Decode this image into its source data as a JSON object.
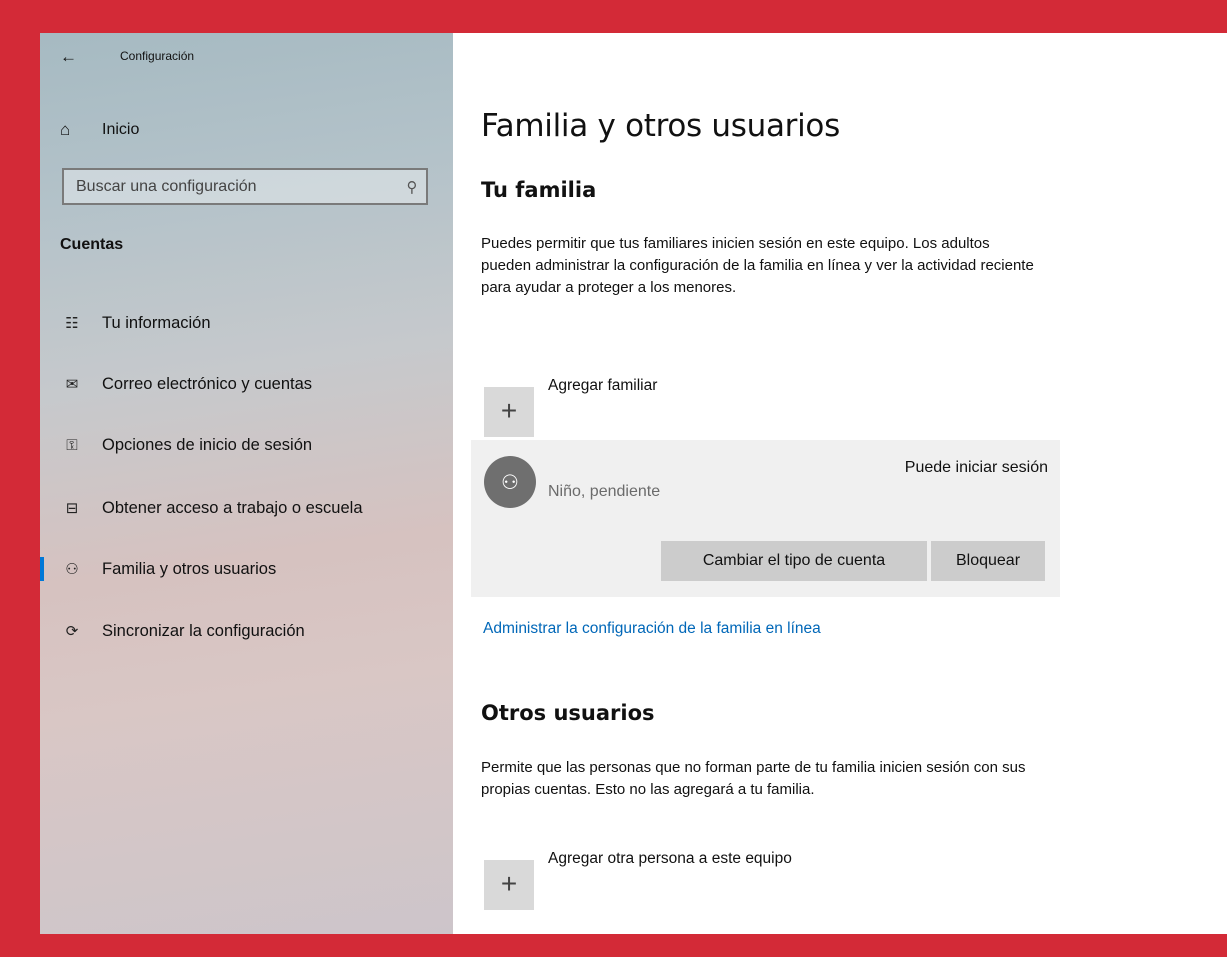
{
  "colors": {
    "frame": "#d32a37",
    "accent": "#0078d7",
    "link": "#0067b8"
  },
  "header": {
    "back_icon": "←",
    "app_title": "Configuración"
  },
  "sidebar": {
    "home": {
      "icon": "⌂",
      "label": "Inicio"
    },
    "search": {
      "placeholder": "Buscar una configuración",
      "icon": "⚲"
    },
    "section_heading": "Cuentas",
    "items": [
      {
        "icon": "☷",
        "icon_name": "contact-info-icon",
        "label": "Tu información",
        "active": false
      },
      {
        "icon": "✉",
        "icon_name": "mail-icon",
        "label": "Correo electrónico y cuentas",
        "active": false
      },
      {
        "icon": "⚿",
        "icon_name": "key-icon",
        "label": "Opciones de inicio de sesión",
        "active": false
      },
      {
        "icon": "⊟",
        "icon_name": "briefcase-icon",
        "label": "Obtener acceso a trabajo o escuela",
        "active": false
      },
      {
        "icon": "⚇",
        "icon_name": "person-add-icon",
        "label": "Familia y otros usuarios",
        "active": true
      },
      {
        "icon": "⟳",
        "icon_name": "sync-icon",
        "label": "Sincronizar la configuración",
        "active": false
      }
    ]
  },
  "main": {
    "title": "Familia y otros usuarios",
    "family": {
      "heading": "Tu familia",
      "description": "Puedes permitir que tus familiares inicien sesión en este equipo. Los adultos pueden administrar la configuración de la familia en línea y ver la actividad reciente para ayudar a proteger a los menores.",
      "add_label": "Agregar familiar",
      "add_icon": "+",
      "member": {
        "avatar_icon": "⚇",
        "name": "Niño, pendiente",
        "status": "Puede iniciar sesión",
        "change_button": "Cambiar el tipo de cuenta",
        "block_button": "Bloquear"
      },
      "manage_link": "Administrar la configuración de la familia en línea"
    },
    "others": {
      "heading": "Otros usuarios",
      "description": "Permite que las personas que no forman parte de tu familia inicien sesión con sus propias cuentas. Esto no las agregará a tu familia.",
      "add_label": "Agregar otra persona a este equipo",
      "add_icon": "+"
    }
  }
}
